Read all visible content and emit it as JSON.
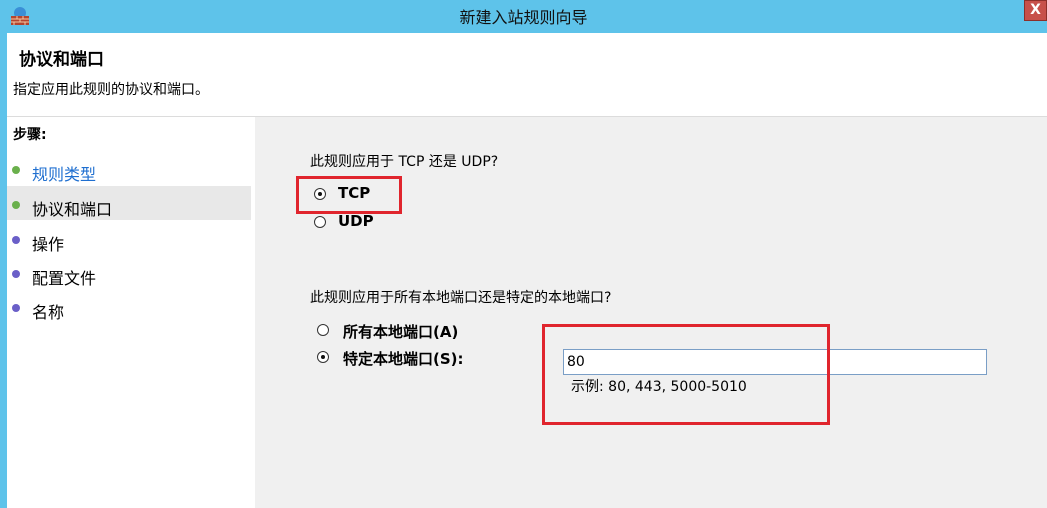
{
  "window": {
    "title": "新建入站规则向导",
    "close_label": "X",
    "app_icon": "firewall-wall-icon"
  },
  "header": {
    "title": "协议和端口",
    "description": "指定应用此规则的协议和端口。"
  },
  "steps": {
    "title": "步骤:",
    "items": [
      {
        "label": "规则类型",
        "status": "completed",
        "dot_color": "#6ab04c"
      },
      {
        "label": "协议和端口",
        "status": "current",
        "dot_color": "#6ab04c"
      },
      {
        "label": "操作",
        "status": "pending",
        "dot_color": "#6a5fc8"
      },
      {
        "label": "配置文件",
        "status": "pending",
        "dot_color": "#6a5fc8"
      },
      {
        "label": "名称",
        "status": "pending",
        "dot_color": "#6a5fc8"
      }
    ]
  },
  "protocol": {
    "question": "此规则应用于 TCP 还是 UDP?",
    "options": [
      {
        "label": "TCP",
        "checked": true
      },
      {
        "label": "UDP",
        "checked": false
      }
    ]
  },
  "ports": {
    "question": "此规则应用于所有本地端口还是特定的本地端口?",
    "options": [
      {
        "label": "所有本地端口(A)",
        "checked": false
      },
      {
        "label": "特定本地端口(S):",
        "checked": true
      }
    ],
    "input_value": "80",
    "example": "示例: 80, 443, 5000-5010"
  },
  "colors": {
    "titlebar": "#5ec3ea",
    "highlight": "#e0252d",
    "link": "#1f6fd0"
  }
}
